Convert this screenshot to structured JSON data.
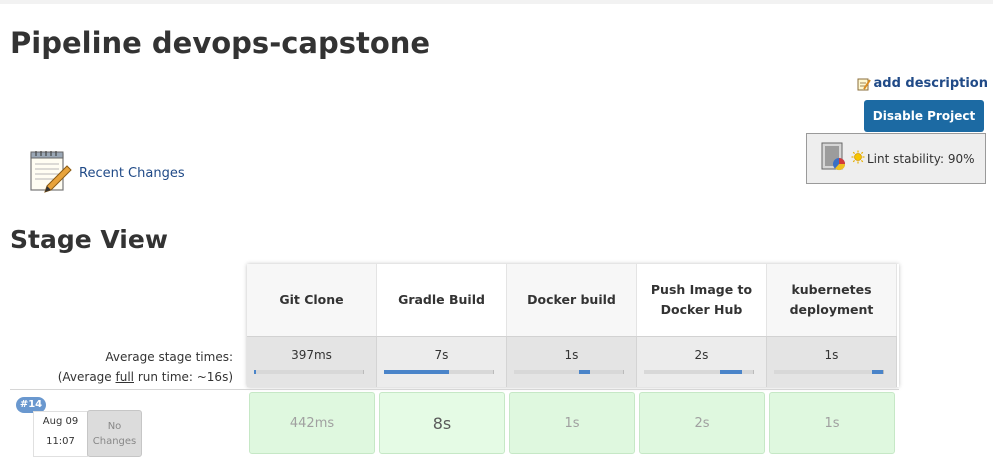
{
  "header": {
    "title": "Pipeline devops-capstone",
    "add_description": "add description",
    "disable_button": "Disable Project"
  },
  "lint": {
    "label": "Lint stability: 90%"
  },
  "recent_changes": {
    "label": "Recent Changes"
  },
  "stage_view": {
    "heading": "Stage View",
    "avg_label": "Average stage times:",
    "avg_full_prefix": "(Average ",
    "avg_full_link": "full",
    "avg_full_suffix": " run time: ~16s)",
    "stages": [
      {
        "name": "Git Clone",
        "avg": "397ms",
        "share": 0.0
      },
      {
        "name": "Gradle Build",
        "avg": "7s",
        "share": 0.6
      },
      {
        "name": "Docker build",
        "avg": "1s",
        "share": 0.1
      },
      {
        "name": "Push Image to Docker Hub",
        "avg": "2s",
        "share": 0.2
      },
      {
        "name": "kubernetes deployment",
        "avg": "1s",
        "share": 0.1
      }
    ]
  },
  "builds": [
    {
      "number": "#14",
      "month_day": "Aug 09",
      "time": "11:07",
      "changes": "No Changes",
      "durations": [
        "442ms",
        "8s",
        "1s",
        "2s",
        "1s"
      ]
    }
  ]
}
